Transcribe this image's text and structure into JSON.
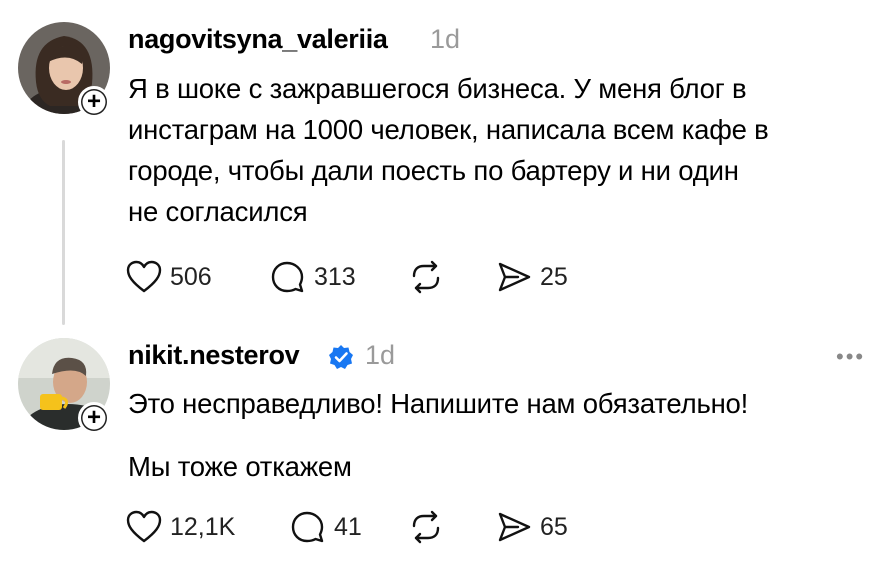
{
  "posts": [
    {
      "username": "nagovitsyna_valeriia",
      "time": "1d",
      "lines": [
        "Я в шоке с зажравшегося бизнеса. У меня блог в",
        "инстаграм на 1000 человек, написала всем кафе в",
        "городе, чтобы дали поесть по бартеру и ни один",
        "не согласился"
      ],
      "likes": "506",
      "comments": "313",
      "shares": "25"
    },
    {
      "username": "nikit.nesterov",
      "verified": true,
      "time": "1d",
      "line1": "Это несправедливо! Напишите нам обязательно!",
      "line2": "Мы тоже откажем",
      "likes": "12,1K",
      "comments": "41",
      "shares": "65",
      "more": "•••"
    }
  ],
  "colors": {
    "text": "#000000",
    "muted": "#9a9a9a",
    "verified": "#1877f2",
    "thread_line": "#d9d9d9"
  },
  "icons": [
    "heart-icon",
    "comment-icon",
    "repost-icon",
    "share-icon",
    "plus-icon",
    "verified-badge-icon",
    "more-icon"
  ]
}
